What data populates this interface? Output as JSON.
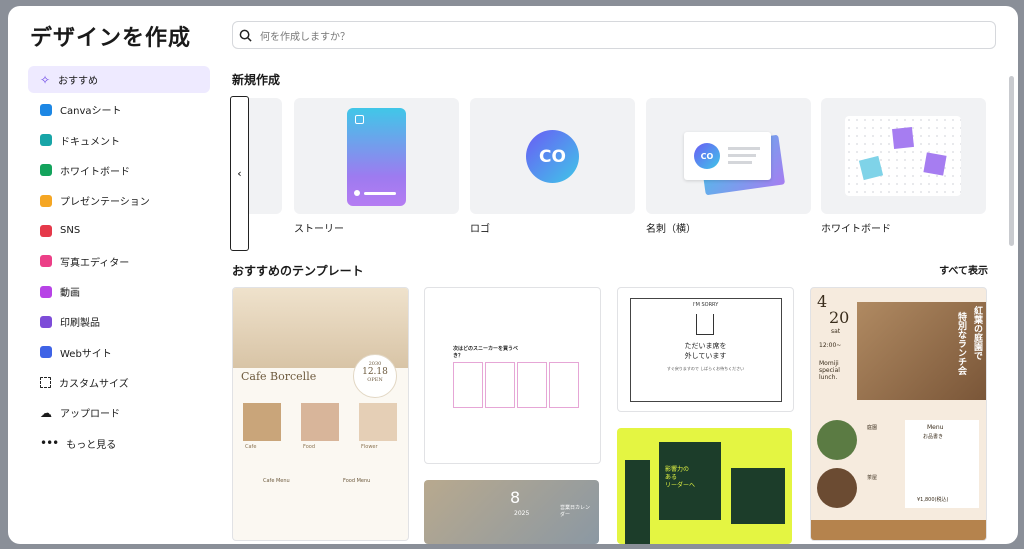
{
  "title": "デザインを作成",
  "search": {
    "placeholder": "何を作成しますか？"
  },
  "sidebar": {
    "items": [
      {
        "label": "おすすめ",
        "icon": "sparkle-icon",
        "color": "#6b46e6"
      },
      {
        "label": "Canvaシート",
        "icon": "sheet-icon",
        "color": "#1d87e4"
      },
      {
        "label": "ドキュメント",
        "icon": "doc-icon",
        "color": "#18a5a7"
      },
      {
        "label": "ホワイトボード",
        "icon": "whiteboard-icon",
        "color": "#13a35c"
      },
      {
        "label": "プレゼンテーション",
        "icon": "presentation-icon",
        "color": "#f5a623"
      },
      {
        "label": "SNS",
        "icon": "heart-icon",
        "color": "#e5394a"
      },
      {
        "label": "写真エディター",
        "icon": "camera-icon",
        "color": "#ec3f87"
      },
      {
        "label": "動画",
        "icon": "video-icon",
        "color": "#b743e6"
      },
      {
        "label": "印刷製品",
        "icon": "print-icon",
        "color": "#7d4cd8"
      },
      {
        "label": "Webサイト",
        "icon": "web-icon",
        "color": "#3f63e6"
      },
      {
        "label": "カスタムサイズ",
        "icon": "custom-size-icon",
        "color": "#222222"
      },
      {
        "label": "アップロード",
        "icon": "upload-icon",
        "color": "#222222"
      },
      {
        "label": "もっと見る",
        "icon": "more-icon",
        "color": "#222222"
      }
    ]
  },
  "new_section": {
    "title": "新規作成",
    "cards": [
      {
        "label": "ストーリー"
      },
      {
        "label": "ロゴ"
      },
      {
        "label": "名刺（横）"
      },
      {
        "label": "ホワイトボード"
      }
    ],
    "logo_text": "CO"
  },
  "templates": {
    "title": "おすすめのテンプレート",
    "see_all": "すべて表示",
    "cafe": {
      "name": "Cafe Borcelle",
      "date": "12.18",
      "day": "OPEN",
      "year": "2030",
      "labels": [
        "Cafe",
        "Food",
        "Flower"
      ],
      "menu1": "Cafe Menu",
      "menu2": "Food Menu"
    },
    "sneaker": {
      "title": "次はどのスニーカーを買うべき？"
    },
    "sorry": {
      "head": "I'M SORRY",
      "line1": "ただいま席を",
      "line2": "外しています",
      "small": "すぐ戻りますので しばらくお待ちください"
    },
    "lunch": {
      "month": "4",
      "day": "20",
      "dow": "sat",
      "time": "12:00~",
      "name": "Momiji special lunch.",
      "vertical1": "紅葉の庭園で",
      "vertical2": "特別なランチ会",
      "menu": "Menu",
      "menu_sub": "お品書き",
      "price": "¥1,800(税込)",
      "court": "庭園",
      "tea": "茶屋"
    },
    "leader": {
      "line1": "影響力の",
      "line2": "ある",
      "line3": "リーダーへ"
    },
    "calendar": {
      "number": "8",
      "year": "2025",
      "label": "営業日カレンダー"
    }
  },
  "colors": {
    "accent": "#8b3dff",
    "active_bg": "#eeeaff",
    "lime": "#e4f542",
    "green_dark": "#1c3d2a"
  }
}
